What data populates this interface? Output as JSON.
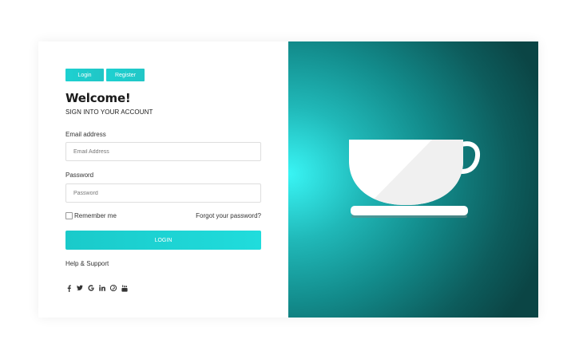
{
  "tabs": {
    "login_label": "Login",
    "register_label": "Register"
  },
  "header": {
    "title": "Welcome!",
    "subtitle": "SIGN INTO YOUR ACCOUNT"
  },
  "form": {
    "email_label": "Email address",
    "email_placeholder": "Email Address",
    "email_value": "",
    "password_label": "Password",
    "password_placeholder": "Password",
    "password_value": "",
    "remember_label": "Remember me",
    "remember_checked": false,
    "forgot_label": "Forgot your password?",
    "submit_label": "LOGIN"
  },
  "help_label": "Help & Support",
  "social_icons": [
    "facebook-icon",
    "twitter-icon",
    "google-icon",
    "linkedin-icon",
    "pinterest-icon",
    "youtube-icon"
  ],
  "colors": {
    "accent": "#1dd1d1",
    "panel_glow": "#39f5f5",
    "panel_dark": "#0b4545",
    "cup": "#ffffff",
    "cup_shade": "#f0f0f0",
    "saucer_shadow": "#6a8a8a"
  },
  "illustration": "coffee-cup-illustration"
}
